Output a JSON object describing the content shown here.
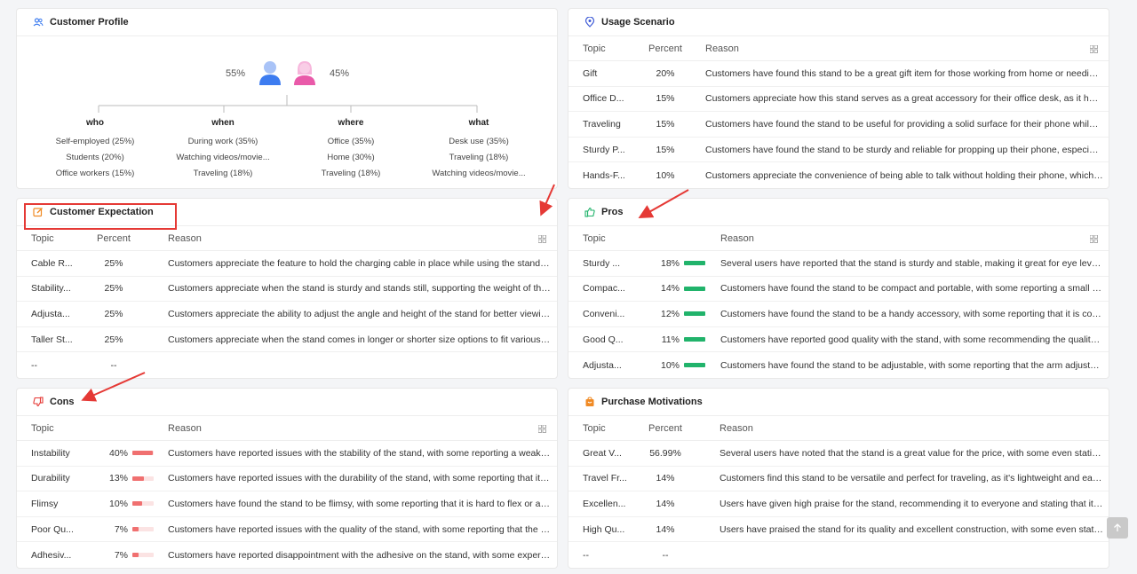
{
  "profile": {
    "title": "Customer Profile",
    "male_pct": "55%",
    "female_pct": "45%",
    "columns": [
      {
        "head": "who",
        "items": [
          "Self-employed (25%)",
          "Students (20%)",
          "Office workers (15%)"
        ]
      },
      {
        "head": "when",
        "items": [
          "During work (35%)",
          "Watching videos/movie...",
          "Traveling (18%)"
        ]
      },
      {
        "head": "where",
        "items": [
          "Office (35%)",
          "Home (30%)",
          "Traveling (18%)"
        ]
      },
      {
        "head": "what",
        "items": [
          "Desk use (35%)",
          "Traveling (18%)",
          "Watching videos/movie..."
        ]
      }
    ]
  },
  "usage": {
    "title": "Usage Scenario",
    "headers": {
      "topic": "Topic",
      "percent": "Percent",
      "reason": "Reason"
    },
    "rows": [
      {
        "topic": "Gift",
        "pct": "20%",
        "reason": "Customers have found this stand to be a great gift item for those working from home or needing a stand for their phone."
      },
      {
        "topic": "Office D...",
        "pct": "15%",
        "reason": "Customers appreciate how this stand serves as a great accessory for their office desk, as it holds the phone at eye level."
      },
      {
        "topic": "Traveling",
        "pct": "15%",
        "reason": "Customers have found the stand to be useful for providing a solid surface for their phone while traveling."
      },
      {
        "topic": "Sturdy P...",
        "pct": "15%",
        "reason": "Customers have found the stand to be sturdy and reliable for propping up their phone, especially for video calls."
      },
      {
        "topic": "Hands-F...",
        "pct": "10%",
        "reason": "Customers appreciate the convenience of being able to talk without holding their phone, which frees their hands."
      }
    ]
  },
  "expectation": {
    "title": "Customer Expectation",
    "headers": {
      "topic": "Topic",
      "percent": "Percent",
      "reason": "Reason"
    },
    "rows": [
      {
        "topic": "Cable R...",
        "pct": "25%",
        "reason": "Customers appreciate the feature to hold the charging cable in place while using the stand for their phone."
      },
      {
        "topic": "Stability...",
        "pct": "25%",
        "reason": "Customers appreciate when the stand is sturdy and stands still, supporting the weight of the phone or tablet."
      },
      {
        "topic": "Adjusta...",
        "pct": "25%",
        "reason": "Customers appreciate the ability to adjust the angle and height of the stand for better viewing positions."
      },
      {
        "topic": "Taller St...",
        "pct": "25%",
        "reason": "Customers appreciate when the stand comes in longer or shorter size options to fit various desk setups."
      },
      {
        "topic": "--",
        "pct": "--",
        "reason": ""
      }
    ]
  },
  "pros": {
    "title": "Pros",
    "headers": {
      "topic": "Topic",
      "reason": "Reason"
    },
    "rows": [
      {
        "topic": "Sturdy ...",
        "pct": "18%",
        "reason": "Several users have reported that the stand is sturdy and stable, making it great for eye level viewing."
      },
      {
        "topic": "Compac...",
        "pct": "14%",
        "reason": "Customers have found the stand to be compact and portable, with some reporting a small footprint on desks."
      },
      {
        "topic": "Conveni...",
        "pct": "12%",
        "reason": "Customers have found the stand to be a handy accessory, with some reporting that it is convenient daily."
      },
      {
        "topic": "Good Q...",
        "pct": "11%",
        "reason": "Customers have reported good quality with the stand, with some recommending the quality to others."
      },
      {
        "topic": "Adjusta...",
        "pct": "10%",
        "reason": "Customers have found the stand to be adjustable, with some reporting that the arm adjusts easily."
      }
    ]
  },
  "cons": {
    "title": "Cons",
    "headers": {
      "topic": "Topic",
      "reason": "Reason"
    },
    "rows": [
      {
        "topic": "Instability",
        "pct": "40%",
        "level": 0.95,
        "reason": "Customers have reported issues with the stability of the stand, with some reporting a weak base that tips over."
      },
      {
        "topic": "Durability",
        "pct": "13%",
        "level": 0.55,
        "reason": "Customers have reported issues with the durability of the stand, with some reporting that it breaks quickly."
      },
      {
        "topic": "Flimsy",
        "pct": "10%",
        "level": 0.45,
        "reason": "Customers have found the stand to be flimsy, with some reporting that it is hard to flex or adjust."
      },
      {
        "topic": "Poor Qu...",
        "pct": "7%",
        "level": 0.3,
        "reason": "Customers have reported issues with the quality of the stand, with some reporting that the parts are cheap."
      },
      {
        "topic": "Adhesiv...",
        "pct": "7%",
        "level": 0.3,
        "reason": "Customers have reported disappointment with the adhesive on the stand, with some experiencing peeling."
      }
    ]
  },
  "motivations": {
    "title": "Purchase Motivations",
    "headers": {
      "topic": "Topic",
      "percent": "Percent",
      "reason": "Reason"
    },
    "rows": [
      {
        "topic": "Great V...",
        "pct": "56.99%",
        "reason": "Several users have noted that the stand is a great value for the price, with some even stating it is worth it."
      },
      {
        "topic": "Travel Fr...",
        "pct": "14%",
        "reason": "Customers find this stand to be versatile and perfect for traveling, as it's lightweight and easy to carry."
      },
      {
        "topic": "Excellen...",
        "pct": "14%",
        "reason": "Users have given high praise for the stand, recommending it to everyone and stating that it works well."
      },
      {
        "topic": "High Qu...",
        "pct": "14%",
        "reason": "Users have praised the stand for its quality and excellent construction, with some even stating it is solid."
      },
      {
        "topic": "--",
        "pct": "--",
        "reason": ""
      }
    ]
  },
  "colors": {
    "accent_blue": "#3d7cf0",
    "red": "#e53935",
    "green": "#21b36b",
    "orange": "#f08a24"
  }
}
